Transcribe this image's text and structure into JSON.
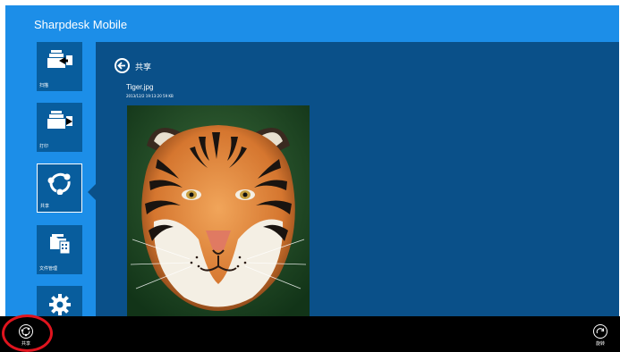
{
  "app": {
    "title": "Sharpdesk Mobile"
  },
  "colors": {
    "app_background": "#1c8ee8",
    "tile_background": "#085d9d",
    "content_background": "#0a5089",
    "app_bar": "#000000",
    "highlight": "#e0141e"
  },
  "sidebar": {
    "items": [
      {
        "label": "扫描",
        "icon": "scan-icon",
        "selected": false
      },
      {
        "label": "打印",
        "icon": "print-icon",
        "selected": false
      },
      {
        "label": "共享",
        "icon": "share-icon",
        "selected": true
      },
      {
        "label": "文件管理",
        "icon": "file-manage-icon",
        "selected": false
      },
      {
        "label": "",
        "icon": "settings-gear-icon",
        "selected": false
      }
    ]
  },
  "main": {
    "title": "共享",
    "file_name": "Tiger.jpg",
    "file_meta": "2013/12/2 19:13:20  59 KB",
    "preview_icon": "tiger-photo"
  },
  "app_bar": {
    "left_button_label": "共享",
    "left_button_icon": "share-icon",
    "right_button_label": "旋转",
    "right_button_icon": "rotate-icon"
  }
}
